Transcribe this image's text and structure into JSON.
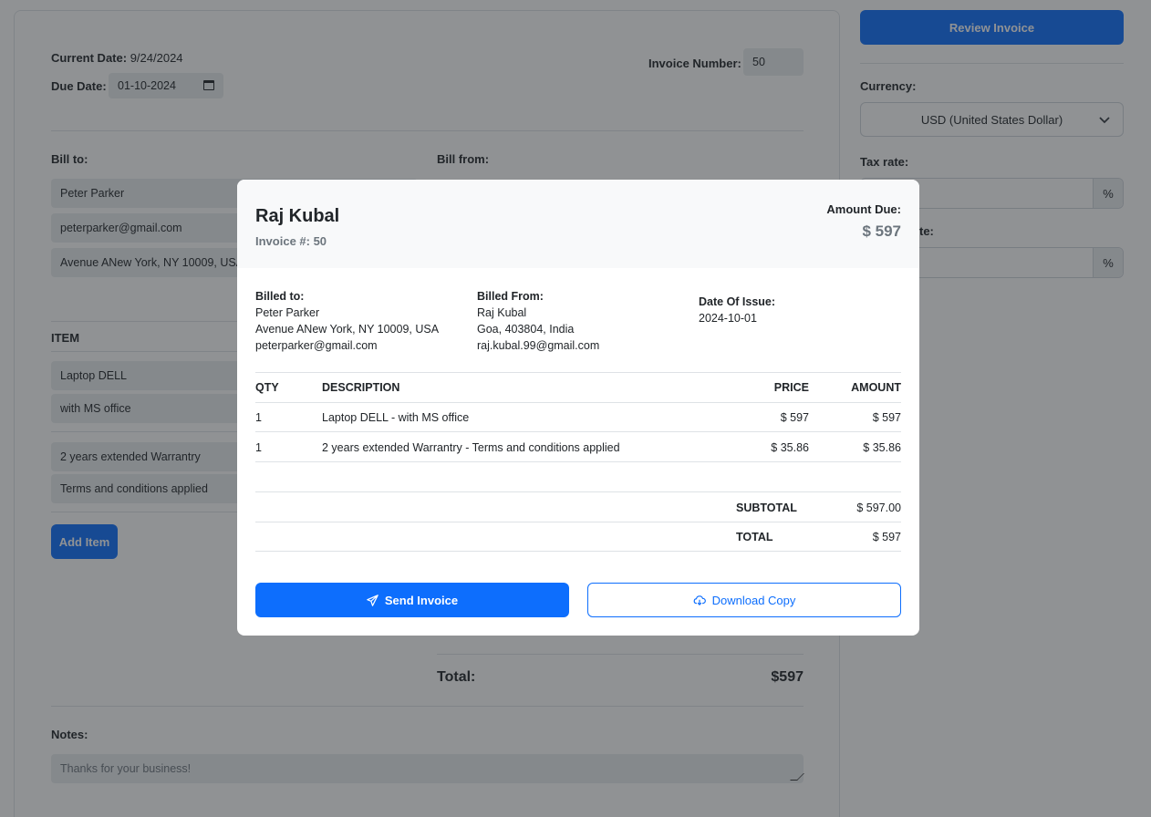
{
  "form": {
    "current_date_label": "Current Date:",
    "current_date": "9/24/2024",
    "due_date_label": "Due Date:",
    "due_date": "01-10-2024",
    "invoice_number_label": "Invoice Number:",
    "invoice_number": "50",
    "bill_to_label": "Bill to:",
    "bill_from_label": "Bill from:",
    "bill_to_name": "Peter Parker",
    "bill_to_email": "peterparker@gmail.com",
    "bill_to_address": "Avenue ANew York, NY 10009, USA",
    "item_header": "ITEM",
    "items": [
      {
        "name": "Laptop DELL",
        "description": "with MS office"
      },
      {
        "name": "2 years extended Warrantry",
        "description": "Terms and conditions applied"
      }
    ],
    "add_item_label": "Add Item",
    "total_label": "Total:",
    "total_value": "$597",
    "notes_label": "Notes:",
    "notes_value": "Thanks for your business!"
  },
  "sidebar": {
    "review_label": "Review Invoice",
    "currency_label": "Currency:",
    "currency_value": "USD (United States Dollar)",
    "tax_label": "Tax rate:",
    "discount_label_fragment": "te:",
    "pct": "%"
  },
  "modal": {
    "from_name": "Raj Kubal",
    "invoice_no": "Invoice #: 50",
    "amount_due_label": "Amount Due:",
    "amount_due": "$ 597",
    "billed_to_label": "Billed to:",
    "billed_to": [
      "Peter Parker",
      "Avenue ANew York, NY 10009, USA",
      "peterparker@gmail.com"
    ],
    "billed_from_label": "Billed From:",
    "billed_from": [
      "Raj Kubal",
      "Goa, 403804, India",
      "raj.kubal.99@gmail.com"
    ],
    "issue_label": "Date Of Issue:",
    "issue_date": "2024-10-01",
    "table": {
      "headers": {
        "qty": "QTY",
        "description": "DESCRIPTION",
        "price": "PRICE",
        "amount": "AMOUNT"
      },
      "rows": [
        {
          "qty": "1",
          "description": "Laptop DELL - with MS office",
          "price": "$ 597",
          "amount": "$ 597"
        },
        {
          "qty": "1",
          "description": "2 years extended Warrantry - Terms and conditions applied",
          "price": "$ 35.86",
          "amount": "$ 35.86"
        }
      ]
    },
    "subtotal_label": "SUBTOTAL",
    "subtotal": "$ 597.00",
    "total_label": "TOTAL",
    "total": "$ 597",
    "send_label": "Send Invoice",
    "download_label": "Download Copy"
  }
}
